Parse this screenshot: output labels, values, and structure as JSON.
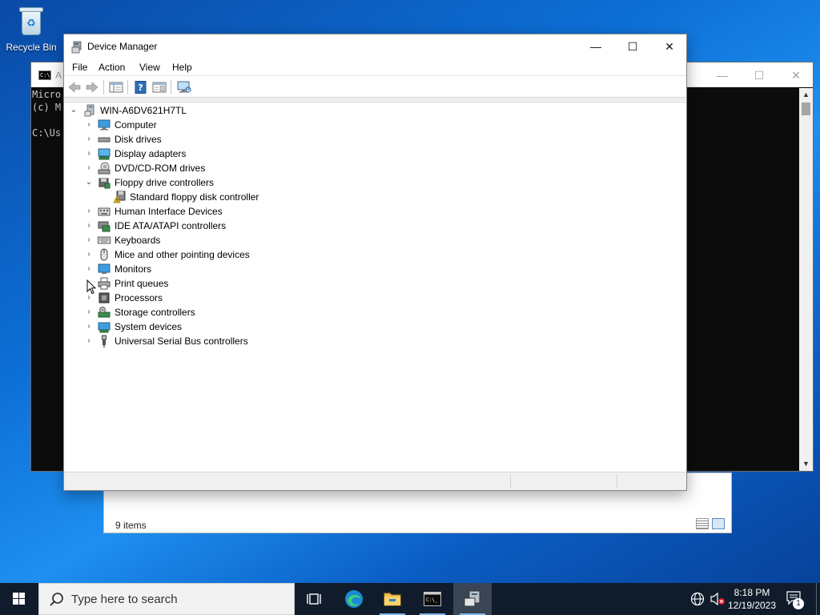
{
  "desktop": {
    "recycle_bin_label": "Recycle Bin"
  },
  "cmd_window": {
    "title": "A",
    "console_lines": [
      "Micro",
      "(c) M",
      "",
      "C:\\Us"
    ]
  },
  "explorer_window": {
    "status_items": "9 items"
  },
  "device_manager": {
    "title": "Device Manager",
    "menu": [
      "File",
      "Action",
      "View",
      "Help"
    ],
    "toolbar": [
      "back-icon",
      "forward-icon",
      "show-hide-console-tree-icon",
      "help-icon",
      "properties-icon",
      "scan-hardware-icon"
    ],
    "root": "WIN-A6DV621H7TL",
    "categories": [
      {
        "label": "Computer",
        "icon": "computer-icon",
        "expanded": false
      },
      {
        "label": "Disk drives",
        "icon": "disk-drive-icon",
        "expanded": false
      },
      {
        "label": "Display adapters",
        "icon": "display-adapter-icon",
        "expanded": false
      },
      {
        "label": "DVD/CD-ROM drives",
        "icon": "dvd-drive-icon",
        "expanded": false
      },
      {
        "label": "Floppy drive controllers",
        "icon": "floppy-controller-icon",
        "expanded": true,
        "children": [
          {
            "label": "Standard floppy disk controller",
            "icon": "warning-device-icon"
          }
        ]
      },
      {
        "label": "Human Interface Devices",
        "icon": "hid-icon",
        "expanded": false
      },
      {
        "label": "IDE ATA/ATAPI controllers",
        "icon": "ide-controller-icon",
        "expanded": false
      },
      {
        "label": "Keyboards",
        "icon": "keyboard-icon",
        "expanded": false
      },
      {
        "label": "Mice and other pointing devices",
        "icon": "mouse-icon",
        "expanded": false
      },
      {
        "label": "Monitors",
        "icon": "monitor-icon",
        "expanded": false
      },
      {
        "label": "Print queues",
        "icon": "printer-icon",
        "expanded": false
      },
      {
        "label": "Processors",
        "icon": "processor-icon",
        "expanded": false
      },
      {
        "label": "Storage controllers",
        "icon": "storage-controller-icon",
        "expanded": false
      },
      {
        "label": "System devices",
        "icon": "system-devices-icon",
        "expanded": false
      },
      {
        "label": "Universal Serial Bus controllers",
        "icon": "usb-icon",
        "expanded": false
      }
    ]
  },
  "taskbar": {
    "search_placeholder": "Type here to search",
    "time": "8:18 PM",
    "date": "12/19/2023",
    "notification_count": "1",
    "apps": [
      "task-view-icon",
      "edge-icon",
      "file-explorer-icon",
      "cmd-icon",
      "device-manager-icon"
    ]
  },
  "colors": {
    "accent": "#0078d7",
    "taskbar": "#101c2c",
    "console_bg": "#0c0c0c"
  }
}
